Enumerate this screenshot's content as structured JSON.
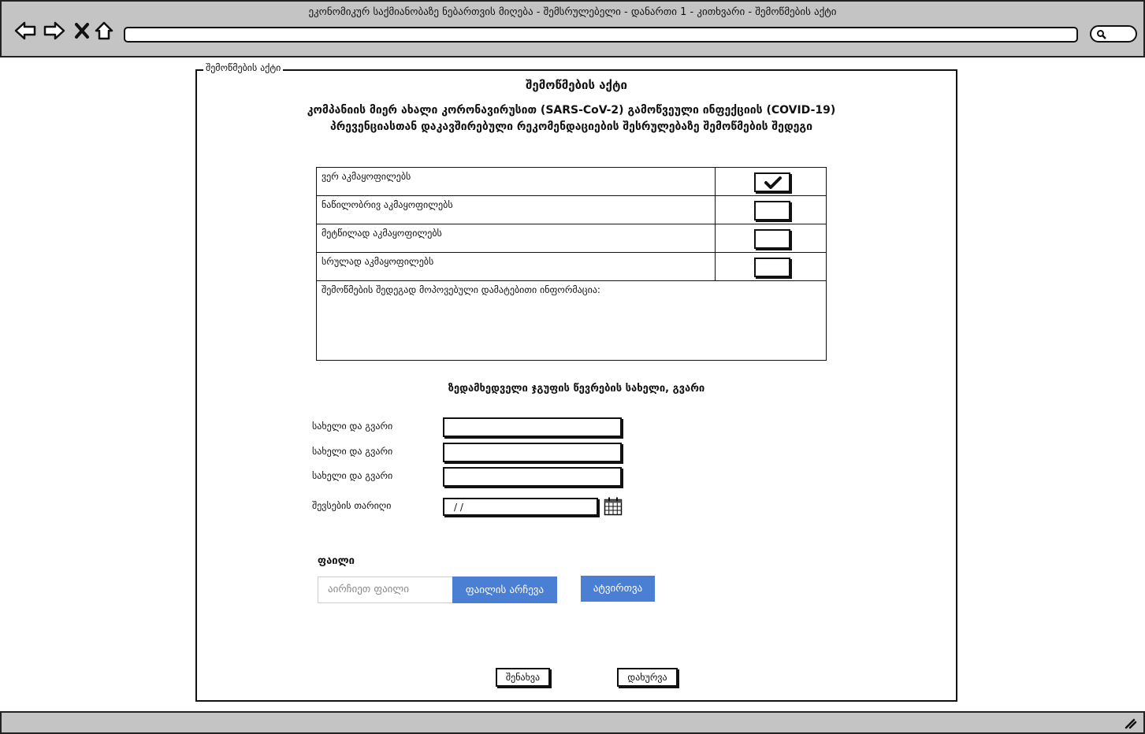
{
  "window": {
    "title": "ეკონომიკურ საქმიანობაზე ნებართვის მიღება - შემსრულებელი - დანართი 1 - კითხვარი - შემოწმების აქტი"
  },
  "form": {
    "legend": "შემოწმების აქტი",
    "title": "შემოწმების აქტი",
    "subtitle_line1": "კომპანიის მიერ ახალი კორონავირუსით (SARS-CoV-2) გამოწვეული ინფექციის (COVID-19)",
    "subtitle_line2": "პრევენციასთან დაკავშირებული რეკომენდაციების შესრულებაზე შემოწმების შედეგი"
  },
  "options": [
    {
      "label": "ვერ აკმაყოფილებს",
      "checked": true
    },
    {
      "label": "ნაწილობრივ აკმაყოფილებს",
      "checked": false
    },
    {
      "label": "მეტწილად აკმაყოფილებს",
      "checked": false
    },
    {
      "label": "სრულად აკმაყოფილებს",
      "checked": false
    }
  ],
  "notes_label": "შემოწმების შედეგად მოპოვებული დამატებითი ინფორმაცია:",
  "group": {
    "title": "ზედამხედველი ჯგუფის წევრების სახელი, გვარი",
    "name_label_1": "სახელი და გვარი",
    "name_label_2": "სახელი და გვარი",
    "name_label_3": "სახელი და გვარი",
    "date_label": "შევსების თარიღი",
    "date_value": "/ /"
  },
  "file": {
    "title": "ფაილი",
    "placeholder": "აირჩიეთ ფაილი",
    "choose_label": "ფაილის არჩევა",
    "upload_label": "ატვირთვა"
  },
  "actions": {
    "save_label": "შენახვა",
    "close_label": "დახურვა"
  }
}
